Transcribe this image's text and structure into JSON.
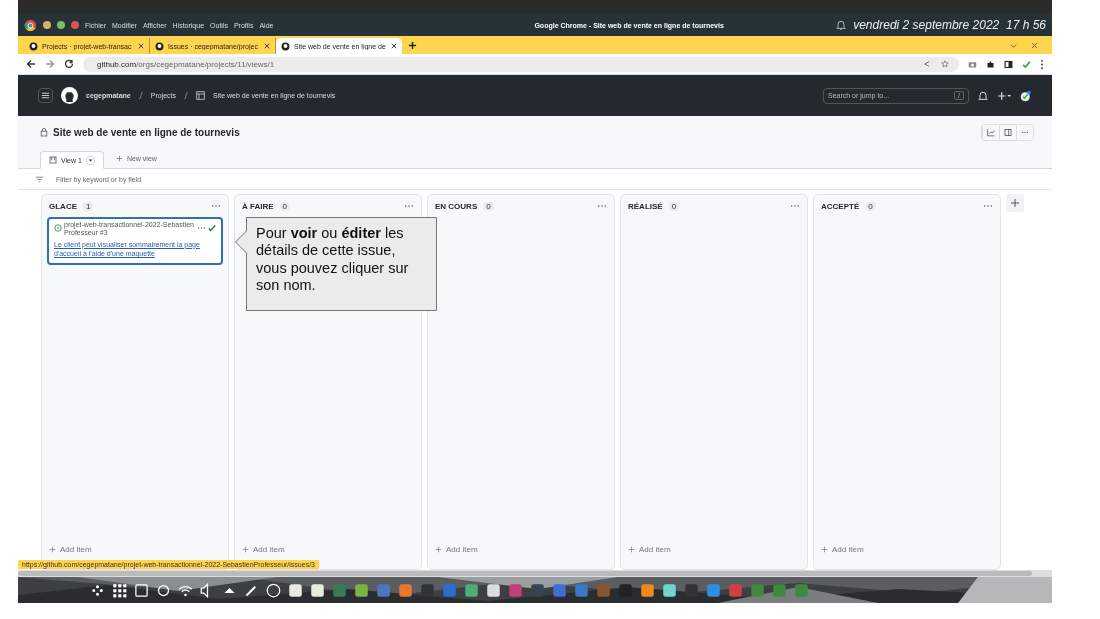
{
  "os_bar": {
    "menu": [
      "Fichier",
      "Modifier",
      "Afficher",
      "Historique",
      "Outils",
      "Profils",
      "Aide"
    ],
    "window_title": "Google Chrome - Site web de vente en ligne de tournevis",
    "clock": "vendredi 2 septembre 2022  17 h 56"
  },
  "tabs": [
    {
      "title": "Projects · projet-web-transac",
      "selected": false
    },
    {
      "title": "Issues · cegepmatane/projec",
      "selected": false
    },
    {
      "title": "Site web de vente en ligne de",
      "selected": true
    }
  ],
  "address": {
    "host": "github.com",
    "path": "/orgs/cegepmatane/projects/11/views/1"
  },
  "header": {
    "breadcrumbs": [
      "cegepmatane",
      "Projects",
      "Site web de vente en ligne de tournevis"
    ],
    "search_placeholder": "Search or jump to...",
    "search_key": "/"
  },
  "project": {
    "title": "Site web de vente en ligne de tournevis",
    "views": [
      {
        "label": "View 1",
        "selected": true
      }
    ],
    "new_view": "New view",
    "filter_placeholder": "Filter by keyword or by field"
  },
  "columns": [
    {
      "name": "GLACE",
      "count": "1",
      "cards": [
        {
          "repo": "projet-web-transactionnel-2022-SebastienProfesseur #3",
          "title": "Le client peut visualiser sommairement la page d'accueil à l'aide d'une maquette",
          "selected": true
        }
      ],
      "add_label": "Add item"
    },
    {
      "name": "À FAIRE",
      "count": "0",
      "add_label": "Add item"
    },
    {
      "name": "EN COURS",
      "count": "0",
      "add_label": "Add item"
    },
    {
      "name": "RÉALISÉ",
      "count": "0",
      "add_label": "Add item"
    },
    {
      "name": "ACCEPTÉ",
      "count": "0",
      "add_label": "Add item"
    }
  ],
  "callout": "Pour **voir** ou **éditer** les détails de cette issue, vous pouvez cliquer sur son nom.",
  "status_url": "https://github.com/cegepmatane/projet-web-transactionnel-2022-SebastienProfesseur/issues/3"
}
